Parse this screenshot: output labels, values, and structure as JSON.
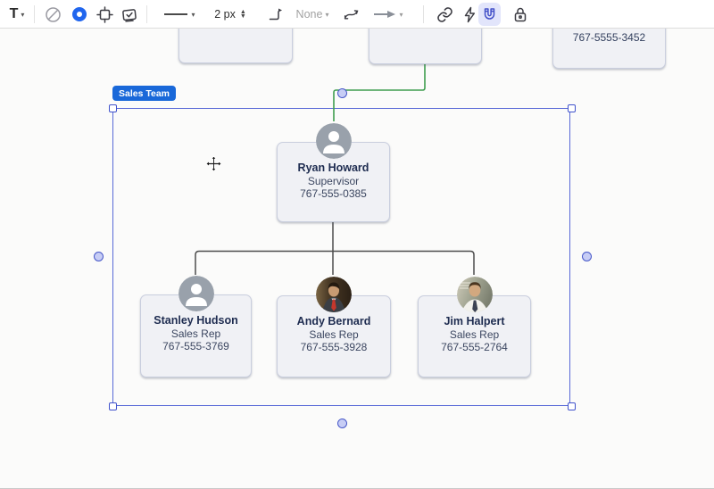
{
  "toolbar": {
    "text_tool_label": "T",
    "stroke_width_value": "2 px",
    "line_start_style_value": "None",
    "icons": {
      "text-tool": "T with dropdown caret",
      "no-fill": "circle with diagonal slash",
      "fill-color": "thick blue ring swatch",
      "crop-frame": "square with edge tick marks",
      "stamp-check": "stamp with checkmark",
      "line-style": "solid horizontal line with dropdown",
      "stroke-width-stepper": "up/down arrows",
      "corner-connector": "elbow line with arrowhead",
      "curve-connector": "curved double arrow",
      "arrow-end-style": "solid arrow with dropdown",
      "link": "chain link",
      "lightning": "lightning bolt",
      "magnet": "snap magnet (active)",
      "lock": "padlock"
    }
  },
  "canvas": {
    "group_label": "Sales Team",
    "top_row_partial_card_phone": "767-5555-3452",
    "org_chart": {
      "root": {
        "name": "Ryan Howard",
        "title": "Supervisor",
        "phone": "767-555-0385"
      },
      "children": [
        {
          "name": "Stanley Hudson",
          "title": "Sales Rep",
          "phone": "767-555-3769"
        },
        {
          "name": "Andy Bernard",
          "title": "Sales Rep",
          "phone": "767-555-3928"
        },
        {
          "name": "Jim Halpert",
          "title": "Sales Rep",
          "phone": "767-555-2764"
        }
      ]
    }
  },
  "colors": {
    "accent_blue": "#2166ee",
    "selection_blue": "#4a5cd4",
    "connector_green": "#3f9e4f",
    "tree_connector_gray": "#4c4c4c",
    "group_label_bg": "#1968d9",
    "card_bg": "#f0f1f5",
    "active_tool_bg": "#e2e5fb"
  }
}
